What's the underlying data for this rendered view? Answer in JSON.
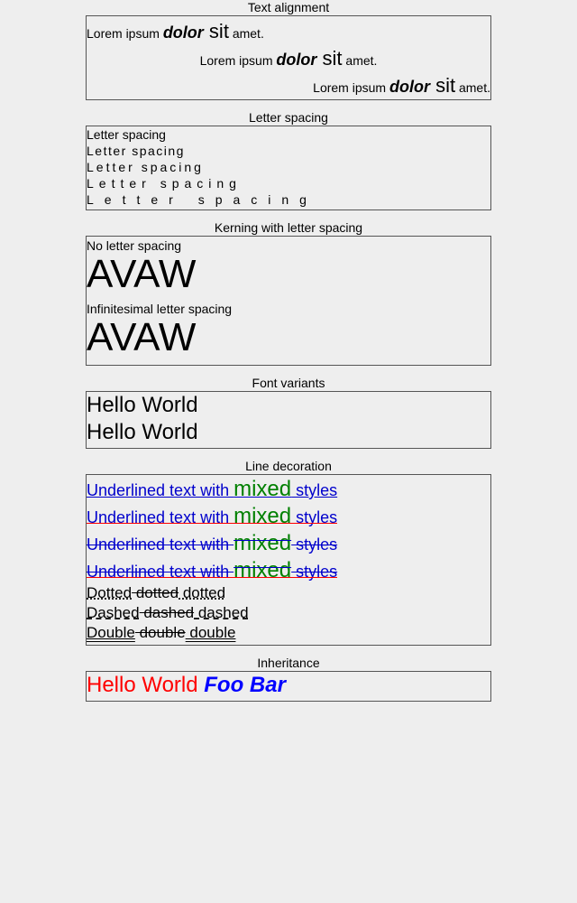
{
  "sections": {
    "text_alignment": {
      "title": "Text alignment",
      "rows": [
        {
          "a": "Lorem ipsum ",
          "b": "dolor",
          "c": " sit",
          "d": " amet."
        },
        {
          "a": "Lorem ipsum ",
          "b": "dolor",
          "c": " sit",
          "d": " amet."
        },
        {
          "a": "Lorem ipsum ",
          "b": "dolor",
          "c": " sit",
          "d": " amet."
        }
      ]
    },
    "letter_spacing": {
      "title": "Letter spacing",
      "rows": [
        "Letter spacing",
        "Letter spacing",
        "Letter spacing",
        "Letter spacing",
        "Letter spacing"
      ]
    },
    "kerning": {
      "title": "Kerning with letter spacing",
      "label1": "No letter spacing",
      "text1": "AVAW",
      "label2": "Infinitesimal letter spacing",
      "text2": "AVAW"
    },
    "font_variants": {
      "title": "Font variants",
      "rows": [
        "Hello World",
        "Hello World"
      ]
    },
    "line_decoration": {
      "title": "Line decoration",
      "mixed_rows": [
        {
          "a": "Underlined text with ",
          "b": "mixed",
          "c": " styles"
        },
        {
          "a": "Underlined text with ",
          "b": "mixed",
          "c": " styles"
        },
        {
          "a": "Underlined text with ",
          "b": "mixed",
          "c": " styles"
        },
        {
          "a": "Underlined text with ",
          "b": "mixed",
          "c": " styles"
        }
      ],
      "dotted": [
        "Dotted",
        " dotted",
        " dotted"
      ],
      "dashed": [
        "Dashed",
        " dashed",
        " dashed"
      ],
      "double": [
        "Double",
        " double",
        " double"
      ]
    },
    "inheritance": {
      "title": "Inheritance",
      "a": "Hello World ",
      "b": "Foo Bar"
    }
  },
  "colors": {
    "background": "#eeeeee",
    "blue": "#0000cc",
    "green": "#008000",
    "red": "#ff0000"
  }
}
